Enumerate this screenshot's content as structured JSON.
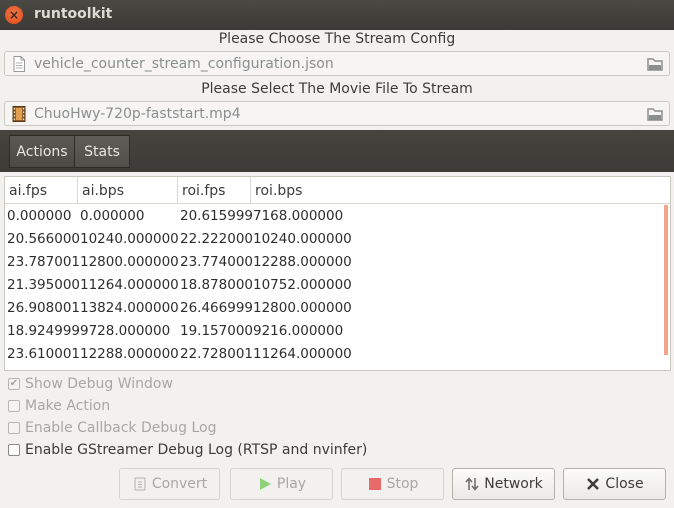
{
  "window": {
    "title": "runtoolkit",
    "close_glyph": "×"
  },
  "config": {
    "label": "Please Choose The Stream Config",
    "file": "vehicle_counter_stream_configuration.json",
    "icon": "document-icon"
  },
  "movie": {
    "label": "Please Select The Movie File To Stream",
    "file": "ChuoHwy-720p-faststart.mp4",
    "icon": "film-icon"
  },
  "tabs": [
    {
      "label": "Actions"
    },
    {
      "label": "Stats"
    }
  ],
  "stats_table": {
    "columns": [
      "ai.fps",
      "ai.bps",
      "roi.fps",
      "roi.bps"
    ],
    "rows": [
      [
        "0.000000",
        "0.000000",
        "20.615999",
        "7168.000000"
      ],
      [
        "20.566000",
        "10240.000000",
        "22.222000",
        "10240.000000"
      ],
      [
        "23.787001",
        "12800.000000",
        "23.774000",
        "12288.000000"
      ],
      [
        "21.395000",
        "11264.000000",
        "18.878000",
        "10752.000000"
      ],
      [
        "26.908001",
        "13824.000000",
        "26.466999",
        "12800.000000"
      ],
      [
        "18.924999",
        "9728.000000",
        "19.157000",
        "9216.000000"
      ],
      [
        "23.610001",
        "12288.000000",
        "22.728001",
        "11264.000000"
      ]
    ]
  },
  "options": [
    {
      "label": "Show Debug Window",
      "checked": true,
      "enabled": false
    },
    {
      "label": "Make Action",
      "checked": false,
      "enabled": false
    },
    {
      "label": "Enable Callback Debug Log",
      "checked": false,
      "enabled": false
    },
    {
      "label": "Enable GStreamer Debug Log (RTSP and nvinfer)",
      "checked": false,
      "enabled": true
    }
  ],
  "buttons": {
    "convert": "Convert",
    "play": "Play",
    "stop": "Stop",
    "network": "Network",
    "close": "Close"
  },
  "colors": {
    "titlebar": "#3c3b37",
    "close_button": "#df4a16",
    "accent_scroll": "#f0a688",
    "play_green": "#8fd07a",
    "stop_red": "#e86b6b"
  }
}
